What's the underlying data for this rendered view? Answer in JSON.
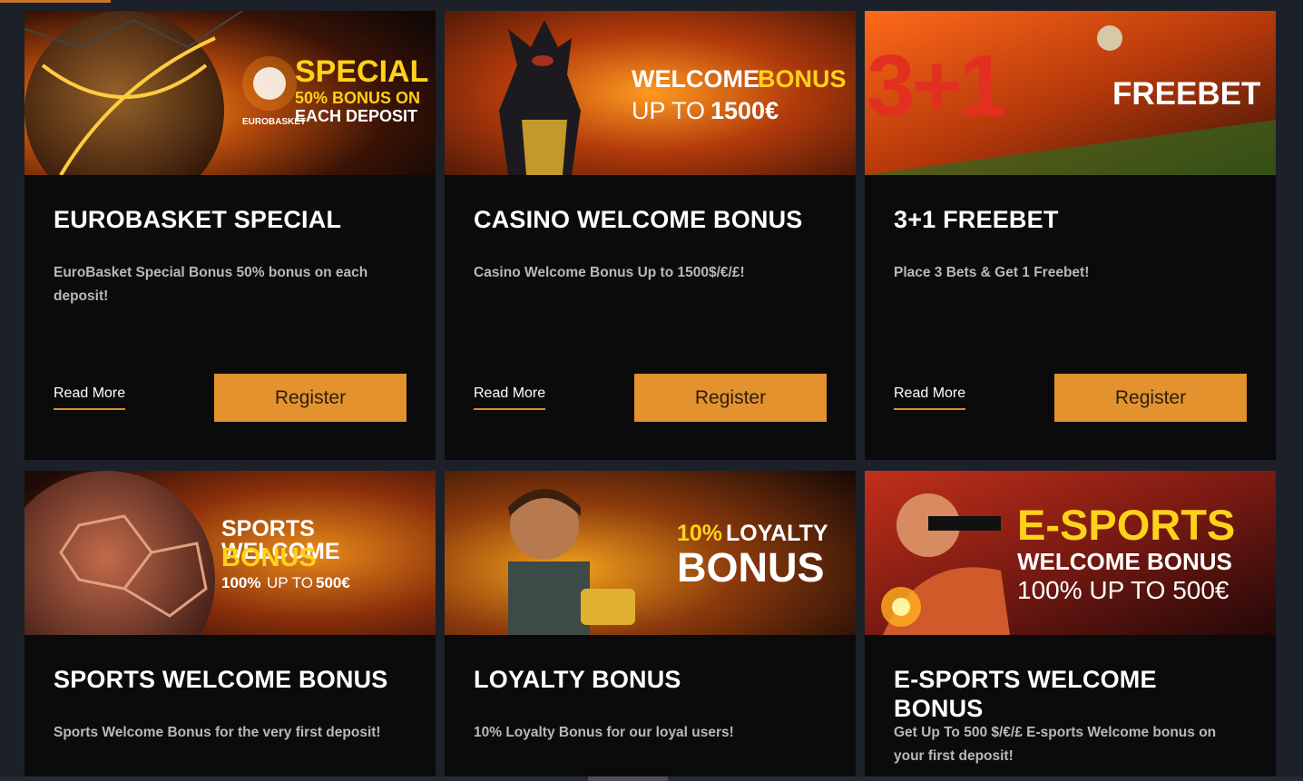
{
  "colors": {
    "page_bg": "#1b2029",
    "card_bg": "#0b0b0c",
    "register_bg": "#e3922d",
    "accent_yellow": "#ffd21a",
    "underline": "#d98d2c"
  },
  "cards": [
    {
      "title": "EUROBASKET SPECIAL",
      "description": "EuroBasket Special Bonus 50% bonus on each deposit!",
      "read_more": "Read More",
      "register": "Register",
      "banner": {
        "icon": "basketball-image",
        "logo_text": "EUROBASKET",
        "line1": "SPECIAL",
        "line2": "50% BONUS ON",
        "line3": "EACH DEPOSIT"
      }
    },
    {
      "title": "CASINO WELCOME BONUS",
      "description": "Casino Welcome Bonus Up to 1500$/€/£!",
      "read_more": "Read More",
      "register": "Register",
      "banner": {
        "icon": "anubis-image",
        "line1a": "WELCOME ",
        "line1b": "BONUS",
        "line2a": "UP TO ",
        "line2b": "1500€"
      }
    },
    {
      "title": "3+1 FREEBET",
      "description": "Place 3 Bets & Get 1 Freebet!",
      "read_more": "Read More",
      "register": "Register",
      "banner": {
        "icon": "3plus1-image",
        "big": "3+1",
        "line1": "FREEBET"
      }
    },
    {
      "title": "SPORTS WELCOME BONUS",
      "description": "Sports Welcome Bonus for the very first deposit!",
      "banner": {
        "icon": "football-image",
        "line1": "SPORTS WELCOME",
        "line2": "BONUS",
        "line3a": "100% ",
        "line3b": "UP TO ",
        "line3c": "500€"
      }
    },
    {
      "title": "LOYALTY BONUS",
      "description": "10% Loyalty Bonus for our loyal users!",
      "banner": {
        "icon": "adventurer-image",
        "line1a": "10% ",
        "line1b": "LOYALTY",
        "line2": "BONUS"
      }
    },
    {
      "title": "E-SPORTS WELCOME BONUS",
      "description": "Get Up To 500 $/€/£ E-sports Welcome bonus on your first deposit!",
      "banner": {
        "icon": "esports-player-image",
        "line1": "E-SPORTS",
        "line2": "WELCOME BONUS",
        "line3": "100% UP TO 500€"
      }
    }
  ]
}
